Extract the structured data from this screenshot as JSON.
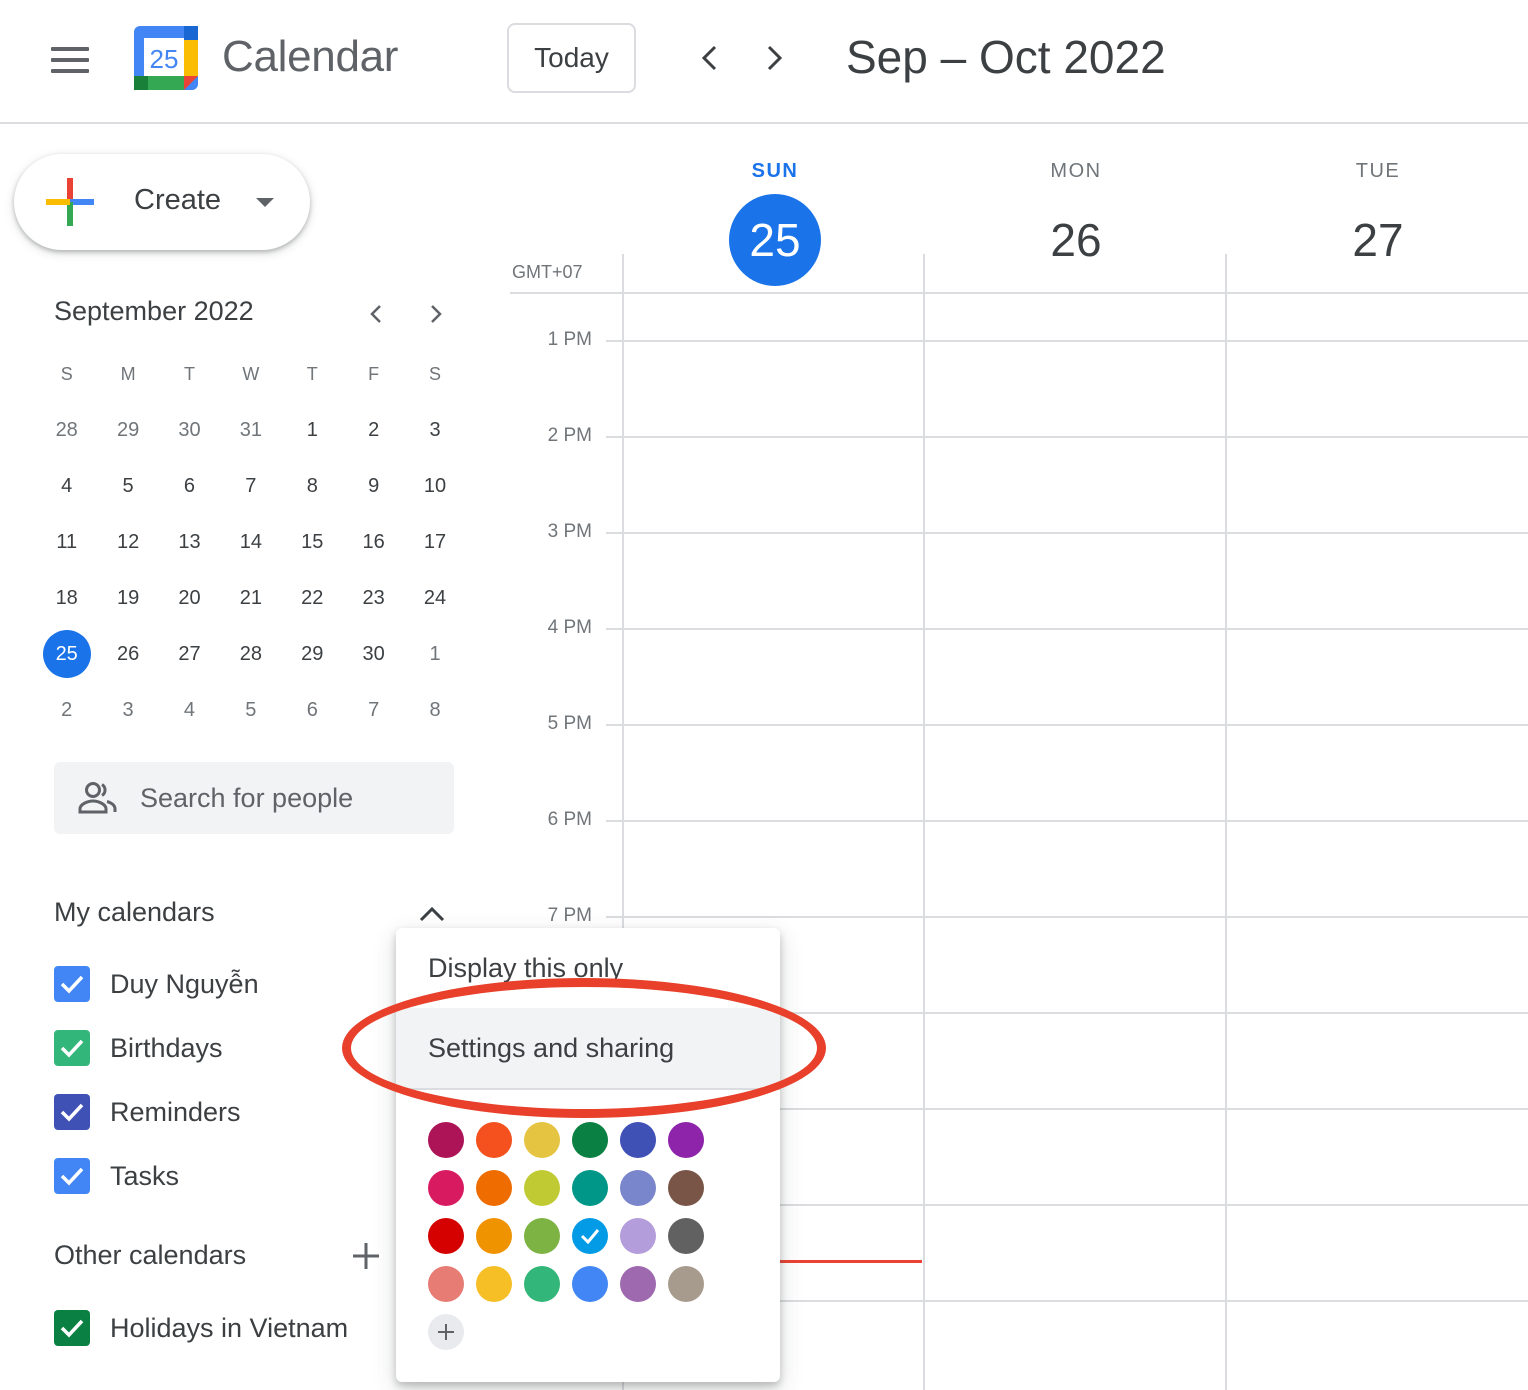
{
  "header": {
    "logo_day": "25",
    "app_title": "Calendar",
    "today_label": "Today",
    "range_title": "Sep – Oct 2022"
  },
  "create": {
    "label": "Create"
  },
  "mini_calendar": {
    "title": "September 2022",
    "weekdays": [
      "S",
      "M",
      "T",
      "W",
      "T",
      "F",
      "S"
    ],
    "weeks": [
      [
        "28",
        "29",
        "30",
        "31",
        "1",
        "2",
        "3"
      ],
      [
        "4",
        "5",
        "6",
        "7",
        "8",
        "9",
        "10"
      ],
      [
        "11",
        "12",
        "13",
        "14",
        "15",
        "16",
        "17"
      ],
      [
        "18",
        "19",
        "20",
        "21",
        "22",
        "23",
        "24"
      ],
      [
        "25",
        "26",
        "27",
        "28",
        "29",
        "30",
        "1"
      ],
      [
        "2",
        "3",
        "4",
        "5",
        "6",
        "7",
        "8"
      ]
    ],
    "today": "25"
  },
  "search": {
    "placeholder": "Search for people"
  },
  "my_calendars": {
    "title": "My calendars",
    "items": [
      {
        "label": "Duy Nguyễn",
        "color": "#4285f4"
      },
      {
        "label": "Birthdays",
        "color": "#33b679"
      },
      {
        "label": "Reminders",
        "color": "#3f51b5"
      },
      {
        "label": "Tasks",
        "color": "#4285f4"
      }
    ]
  },
  "other_calendars": {
    "title": "Other calendars",
    "items": [
      {
        "label": "Holidays in Vietnam",
        "color": "#0b8043"
      }
    ]
  },
  "week_view": {
    "timezone": "GMT+07",
    "days": [
      {
        "name": "SUN",
        "num": "25",
        "today": true
      },
      {
        "name": "MON",
        "num": "26",
        "today": false
      },
      {
        "name": "TUE",
        "num": "27",
        "today": false
      }
    ],
    "hours": [
      "1 PM",
      "2 PM",
      "3 PM",
      "4 PM",
      "5 PM",
      "6 PM",
      "7 PM"
    ]
  },
  "context_menu": {
    "display_only_label": "Display this only",
    "settings_label": "Settings and sharing",
    "colors": [
      [
        "#ad1457",
        "#f4511e",
        "#e4c441",
        "#0b8043",
        "#3f51b5",
        "#8e24aa"
      ],
      [
        "#d81b60",
        "#ef6c00",
        "#c0ca33",
        "#009688",
        "#7986cb",
        "#795548"
      ],
      [
        "#d50000",
        "#f09300",
        "#7cb342",
        "#039be5",
        "#b39ddb",
        "#616161"
      ],
      [
        "#e67c73",
        "#f6bf26",
        "#33b679",
        "#4285f4",
        "#9e69af",
        "#a79b8e"
      ]
    ],
    "selected_color": "#039be5"
  },
  "annotation": {
    "ring_color": "#e8402a"
  }
}
